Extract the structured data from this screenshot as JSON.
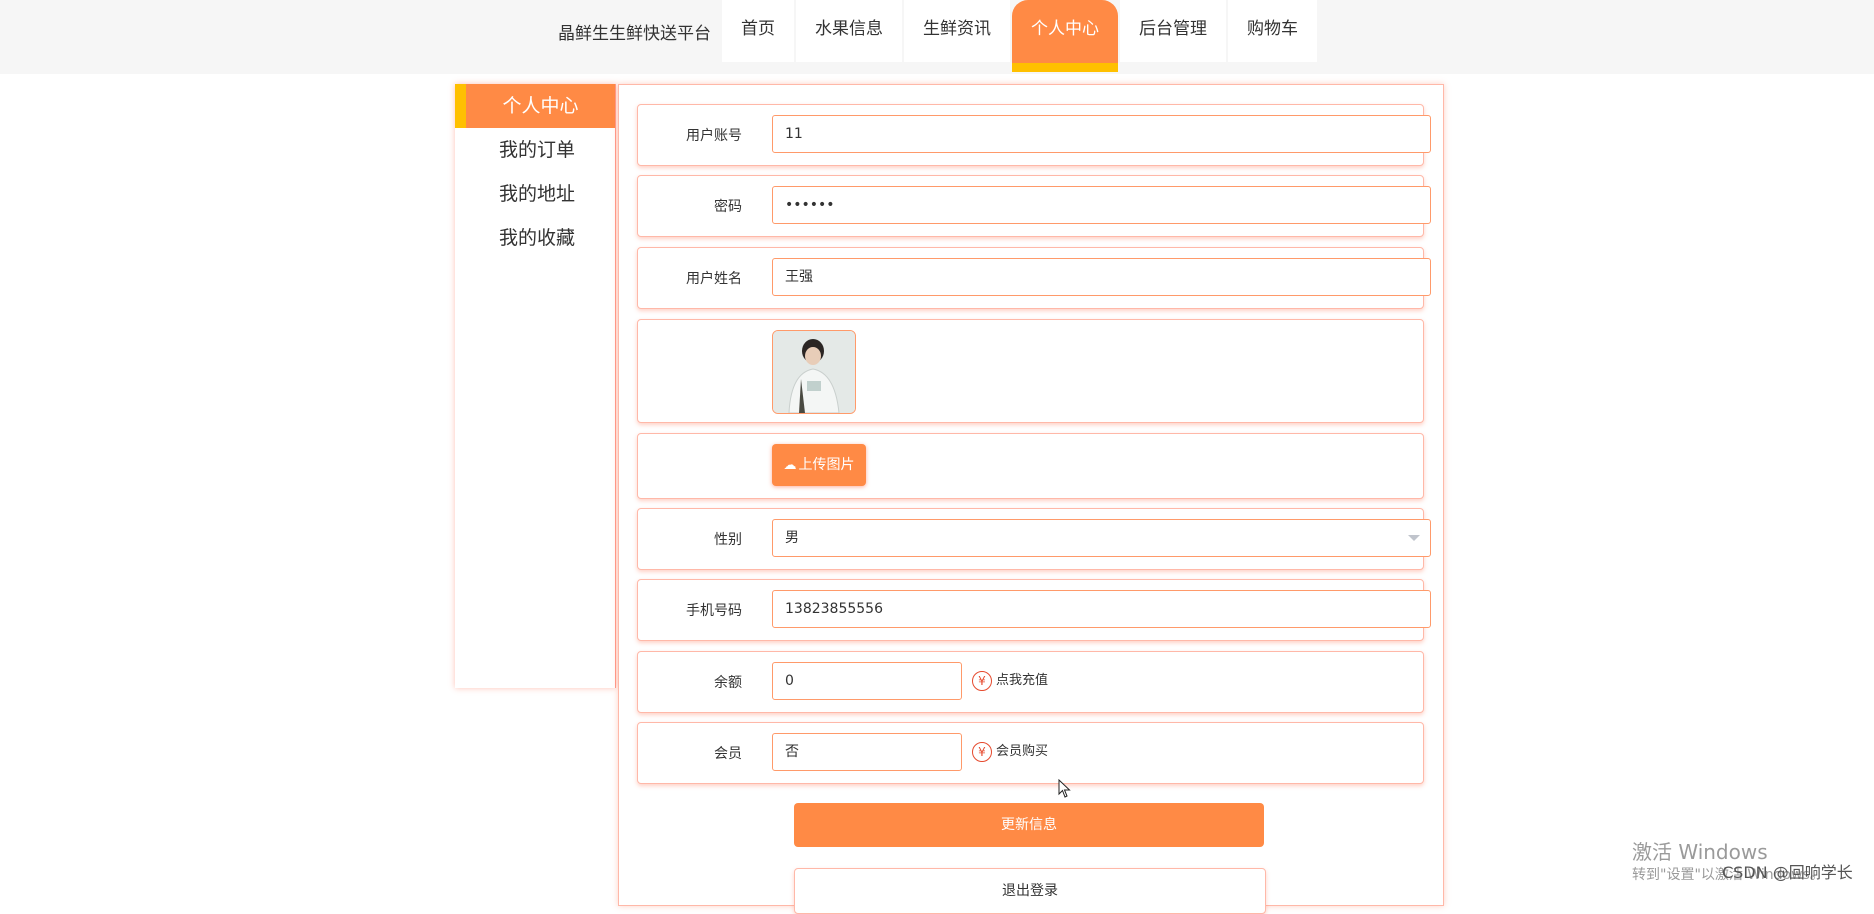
{
  "header": {
    "brand": "晶鲜生生鲜快送平台",
    "nav": [
      {
        "label": "首页",
        "active": false
      },
      {
        "label": "水果信息",
        "active": false
      },
      {
        "label": "生鲜资讯",
        "active": false
      },
      {
        "label": "个人中心",
        "active": true
      },
      {
        "label": "后台管理",
        "active": false
      },
      {
        "label": "购物车",
        "active": false
      }
    ]
  },
  "sidebar": {
    "items": [
      {
        "label": "个人中心",
        "active": true
      },
      {
        "label": "我的订单",
        "active": false
      },
      {
        "label": "我的地址",
        "active": false
      },
      {
        "label": "我的收藏",
        "active": false
      }
    ]
  },
  "form": {
    "account": {
      "label": "用户账号",
      "value": "11"
    },
    "password": {
      "label": "密码",
      "value": "••••••"
    },
    "name": {
      "label": "用户姓名",
      "value": "王强"
    },
    "upload_label": "上传图片",
    "gender": {
      "label": "性别",
      "value": "男"
    },
    "phone": {
      "label": "手机号码",
      "value": "13823855556"
    },
    "balance": {
      "label": "余额",
      "value": "0",
      "action": "点我充值"
    },
    "member": {
      "label": "会员",
      "value": "否",
      "action": "会员购买"
    },
    "update_label": "更新信息",
    "logout_label": "退出登录"
  },
  "overlay": {
    "activate_title": "激活 Windows",
    "activate_hint": "转到\"设置\"以激活 Windows。",
    "csdn": "CSDN @回响学长"
  },
  "colors": {
    "accent": "#ff8a45",
    "highlight": "#ffc000",
    "border": "#ffb8a8"
  }
}
